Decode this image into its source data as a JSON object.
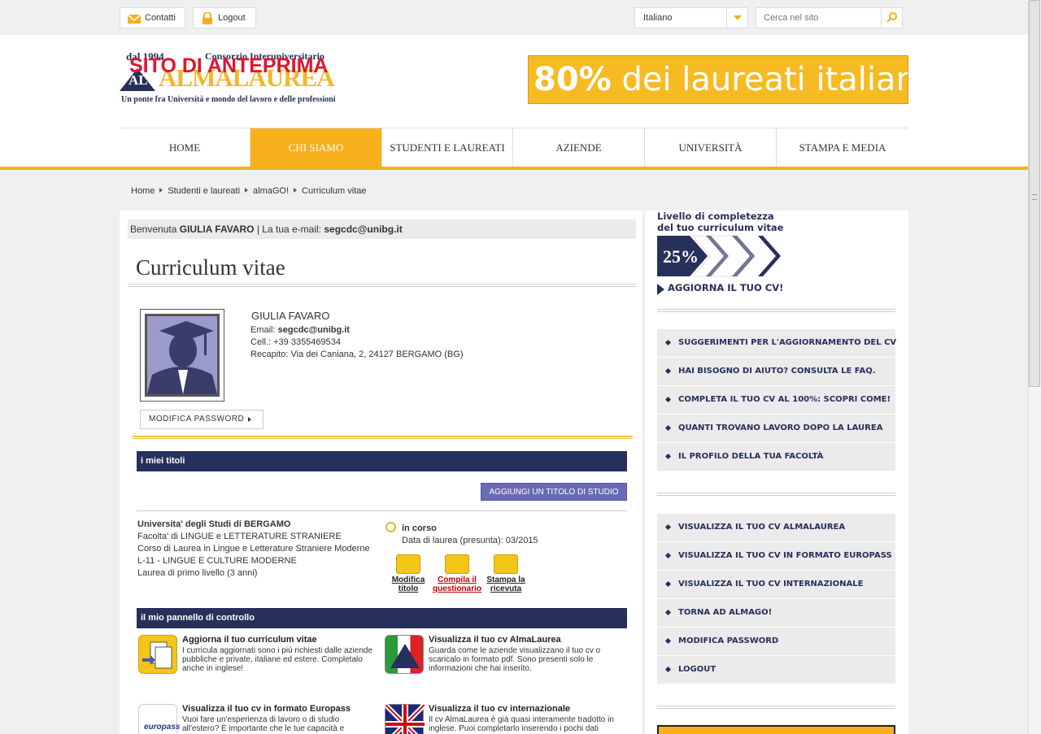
{
  "topbar": {
    "contact_label": "Contatti",
    "logout_label": "Logout",
    "language": "Italiano",
    "search_placeholder": "Cerca nel sito"
  },
  "header": {
    "logo_since": "dal 1994",
    "logo_consortium": "Consorzio Interuniversitario",
    "logo_name": "ALMALAUREA",
    "logo_mark": "AL",
    "logo_tagline": "Un ponte fra Università e mondo del lavoro e delle professioni",
    "preview_stamp": "SITO DI ANTEPRIMA",
    "banner_percent": "80%",
    "banner_text": "dei laureati italiani"
  },
  "nav": {
    "items": [
      "HOME",
      "CHI SIAMO",
      "STUDENTI E LAUREATI",
      "AZIENDE",
      "UNIVERSITÀ",
      "STAMPA E MEDIA"
    ],
    "active": "CHI SIAMO"
  },
  "breadcrumb": [
    "Home",
    "Studenti e laureati",
    "almaGO!",
    "Curriculum vitae"
  ],
  "welcome": {
    "prefix": "Benvenuta",
    "name": "GIULIA FAVARO",
    "email_label": "| La tua e-mail:",
    "email": "segcdc@unibg.it"
  },
  "page_title": "Curriculum vitae",
  "profile": {
    "name": "GIULIA FAVARO",
    "email_label": "Email:",
    "email": "segcdc@unibg.it",
    "phone": "Cell.: +39 3355469534",
    "address": "Recapito: Via dei Caniana, 2, 24127 BERGAMO (BG)",
    "modify_password": "MODIFICA PASSWORD"
  },
  "titles": {
    "header": "i miei titoli",
    "add_button": "AGGIUNGI UN TITOLO DI STUDIO",
    "degree": {
      "university": "Universita' degli Studi di BERGAMO",
      "faculty": "Facolta' di LINGUE e LETTERATURE STRANIERE",
      "course": "Corso di Laurea in Lingue e Letterature Straniere Moderne",
      "class": "L-11 - LINGUE E CULTURE MODERNE",
      "level": "Laurea di primo livello (3 anni)",
      "status": "in corso",
      "date": "Data di laurea (presunta): 03/2015"
    },
    "actions": [
      {
        "line1": "Modifica",
        "line2": "titolo"
      },
      {
        "line1": "Compila il",
        "line2": "questionario"
      },
      {
        "line1": "Stampa la",
        "line2": "ricevuta"
      }
    ]
  },
  "control_panel": {
    "header": "il mio pannello di controllo",
    "items": [
      {
        "title": "Aggiorna il tuo curriculum vitae",
        "desc": "I curricula aggiornati sono i più richiesti dalle aziende pubbliche e private, italiane ed estere. Completalo anche in inglese!"
      },
      {
        "title": "Visualizza il tuo cv AlmaLaurea",
        "desc": "Guarda come le aziende visualizzano il tuo cv o scaricalo in formato pdf. Sono presenti solo le informazioni che hai inserito."
      },
      {
        "title": "Visualizza il tuo cv in formato Europass",
        "desc": "Vuoi fare un'esperienza di lavoro o di studio all'estero? È importante che le tue capacità e"
      },
      {
        "title": "Visualizza il tuo cv internazionale",
        "desc": "Il cv AlmaLaurea è già quasi interamente tradotto in inglese. Puoi completarlo inserendo i pochi dati"
      }
    ],
    "europass_logo": "europass"
  },
  "completeness": {
    "title_line1": "Livello di completezza",
    "title_line2": "del tuo curriculum vitae",
    "percent": "25%",
    "progress": 0.25,
    "update_label": "AGGIORNA IL TUO CV!"
  },
  "right_links_1": [
    "SUGGERIMENTI PER L'AGGIORNAMENTO DEL CV",
    "HAI BISOGNO DI AIUTO? CONSULTA LE FAQ.",
    "COMPLETA IL TUO CV AL 100%: SCOPRI COME!",
    "QUANTI TROVANO LAVORO DOPO LA LAUREA",
    "IL PROFILO DELLA TUA FACOLTÀ"
  ],
  "right_links_2": [
    "VISUALIZZA IL TUO CV ALMALAUREA",
    "VISUALIZZA IL TUO CV IN FORMATO EUROPASS",
    "VISUALIZZA IL TUO CV INTERNAZIONALE",
    "TORNA AD ALMAGO!",
    "MODIFICA PASSWORD",
    "LOGOUT"
  ],
  "colors": {
    "accent": "#f7b01c",
    "navy": "#272f5b",
    "button": "#6a6ab6",
    "banner": "#f6bb22"
  }
}
